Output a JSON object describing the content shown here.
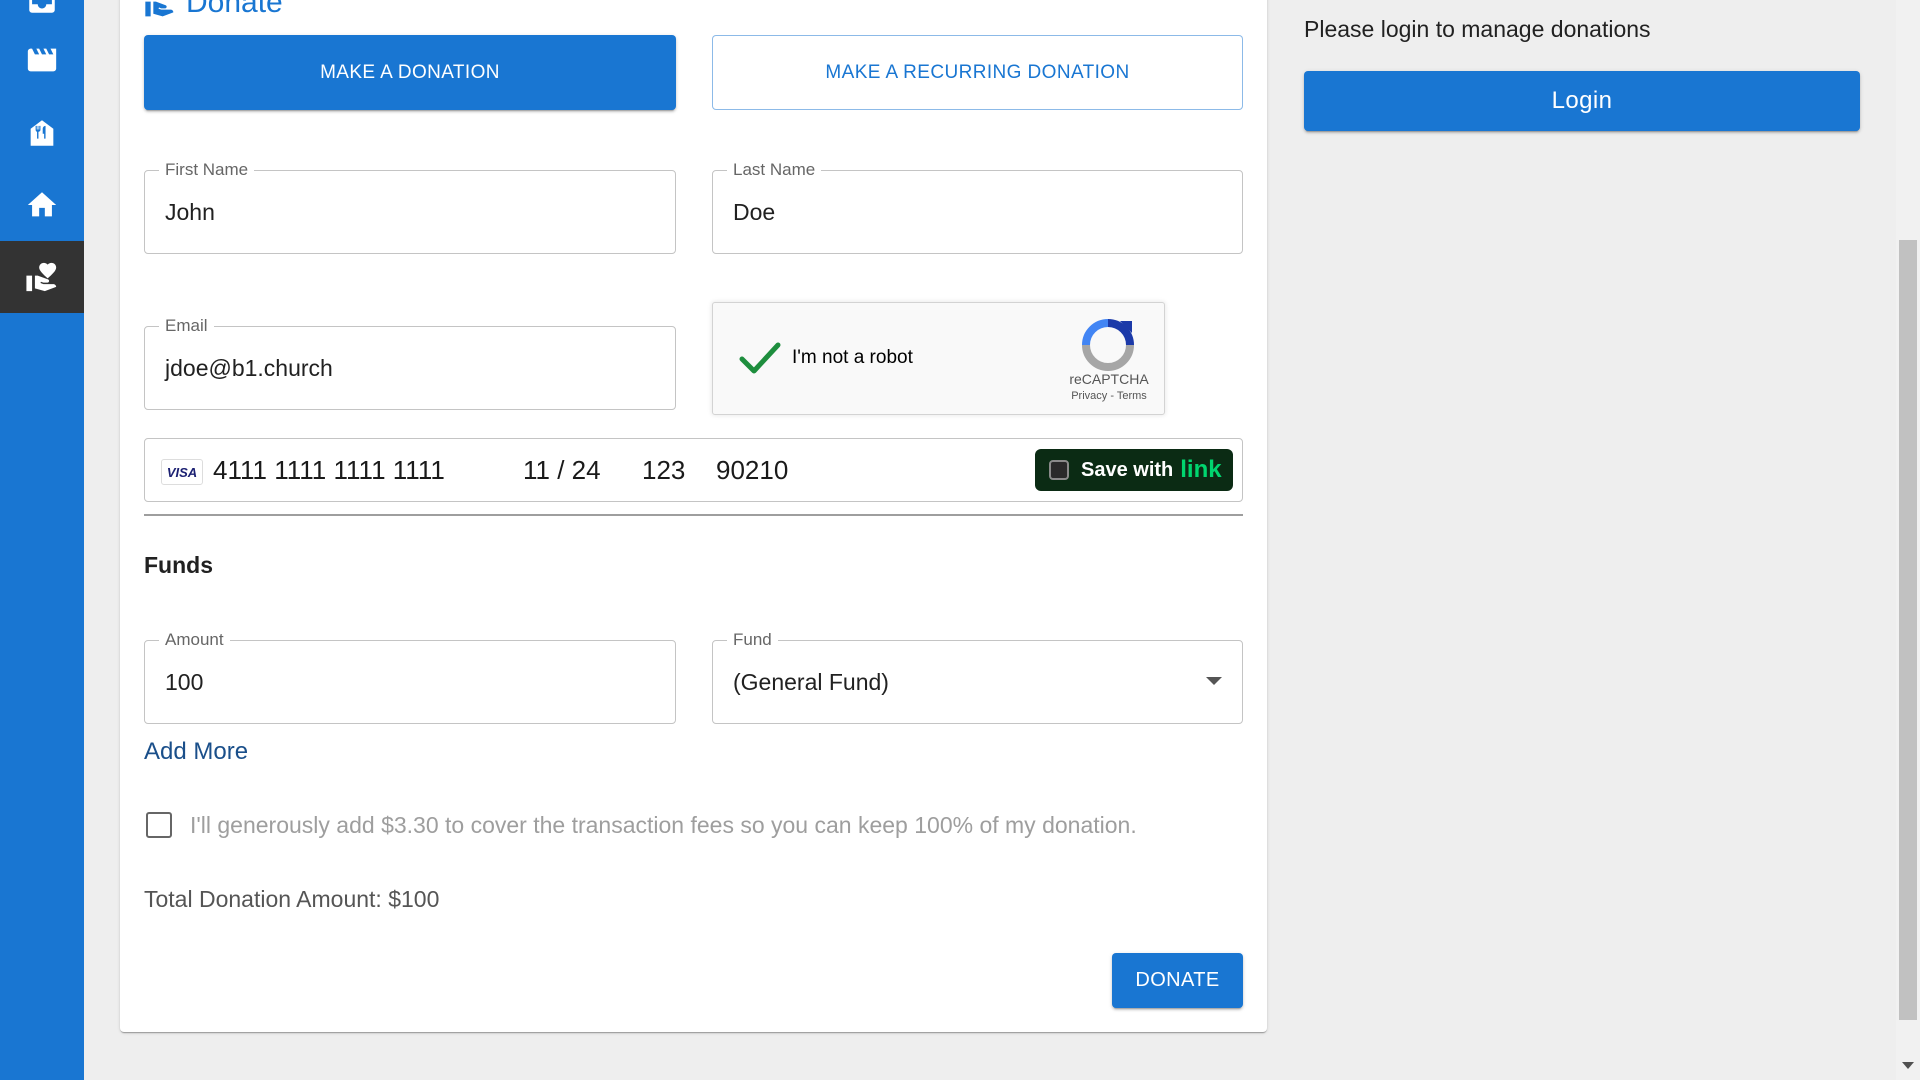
{
  "sidebar": {
    "items": [
      {
        "icon": "inbox-icon"
      },
      {
        "icon": "movie-icon"
      },
      {
        "icon": "restaurant-icon"
      },
      {
        "icon": "home-icon"
      },
      {
        "icon": "volunteer-icon",
        "active": true
      }
    ]
  },
  "donate": {
    "title": "Donate",
    "make_donation_label": "MAKE A DONATION",
    "recurring_label": "MAKE A RECURRING DONATION",
    "first_name": {
      "label": "First Name",
      "value": "John"
    },
    "last_name": {
      "label": "Last Name",
      "value": "Doe"
    },
    "email": {
      "label": "Email",
      "value": "jdoe@b1.church"
    },
    "captcha": {
      "text": "I'm not a robot",
      "brand": "reCAPTCHA",
      "links": "Privacy - Terms"
    },
    "payment": {
      "card_brand": "VISA",
      "card_number": "4111 1111 1111 1111",
      "expiry": "11 / 24",
      "cvc": "123",
      "zip": "90210",
      "save_label": "Save with",
      "link_label": "link"
    },
    "funds_title": "Funds",
    "amount": {
      "label": "Amount",
      "value": "100"
    },
    "fund": {
      "label": "Fund",
      "value": "(General Fund)"
    },
    "add_more": "Add More",
    "fee_text": "I'll generously add $3.30 to cover the transaction fees so you can keep 100% of my donation.",
    "total": "Total Donation Amount: $100",
    "donate_button": "DONATE"
  },
  "account": {
    "message": "Please login to manage donations",
    "login_button": "Login"
  },
  "colors": {
    "primary": "#1976d2",
    "sidebar_active": "#333333",
    "link_green": "#00d66f"
  }
}
